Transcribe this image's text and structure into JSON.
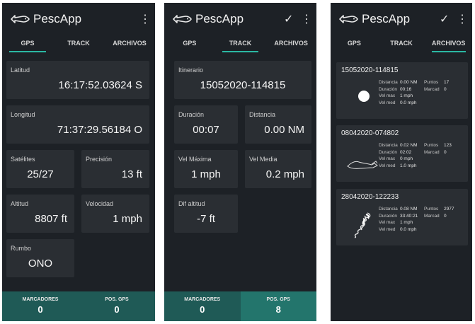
{
  "app": {
    "title": "PescApp"
  },
  "tabs": [
    "GPS",
    "TRACK",
    "ARCHIVOS"
  ],
  "gps_screen": {
    "latitud": {
      "label": "Latitud",
      "value": "16:17:52.03624 S"
    },
    "longitud": {
      "label": "Longitud",
      "value": "71:37:29.56184 O"
    },
    "satelites": {
      "label": "Satélites",
      "value": "25/27"
    },
    "precision": {
      "label": "Precisión",
      "value": "13 ft"
    },
    "altitud": {
      "label": "Altitud",
      "value": "8807 ft"
    },
    "velocidad": {
      "label": "Velocidad",
      "value": "1 mph"
    },
    "rumbo": {
      "label": "Rumbo",
      "value": "ONO"
    },
    "bottom": {
      "marcadores_label": "MARCADORES",
      "marcadores_value": "0",
      "posgps_label": "POS. GPS",
      "posgps_value": "0"
    }
  },
  "track_screen": {
    "itinerario": {
      "label": "Itinerario",
      "value": "15052020-114815"
    },
    "duracion": {
      "label": "Duración",
      "value": "00:07"
    },
    "distancia": {
      "label": "Distancia",
      "value": "0.00 NM"
    },
    "vel_maxima": {
      "label": "Vel Máxima",
      "value": "1 mph"
    },
    "vel_media": {
      "label": "Vel Media",
      "value": "0.2 mph"
    },
    "dif_altitud": {
      "label": "Dif altitud",
      "value": "-7 ft"
    },
    "bottom": {
      "marcadores_label": "MARCADORES",
      "marcadores_value": "0",
      "posgps_label": "POS. GPS",
      "posgps_value": "8"
    }
  },
  "archivos_screen": {
    "stat_labels": {
      "distancia": "Distancia",
      "duracion": "Duración",
      "velmax": "Vel max",
      "velmed": "Vel med",
      "puntos": "Puntos",
      "marcad": "Marcad"
    },
    "tracks": [
      {
        "name": "15052020-114815",
        "distancia": "0.00 NM",
        "duracion": "00:16",
        "velmax": "1 mph",
        "velmed": "0.0 mph",
        "puntos": "17",
        "marcad": "0",
        "thumb": "dot"
      },
      {
        "name": "08042020-074802",
        "distancia": "0.02 NM",
        "duracion": "02:02",
        "velmax": "0 mph",
        "velmed": "1.0 mph",
        "puntos": "123",
        "marcad": "0",
        "thumb": "line"
      },
      {
        "name": "28042020-122233",
        "distancia": "0.08 NM",
        "duracion": "33:40:21",
        "velmax": "1 mph",
        "velmed": "0.0 mph",
        "puntos": "2977",
        "marcad": "0",
        "thumb": "scribble"
      }
    ]
  },
  "icons": {
    "logo": "fish-logo-icon",
    "menu": "more-vert-icon",
    "check": "check-icon"
  },
  "colors": {
    "background": "#1d2126",
    "card": "#2a2e33",
    "accent": "#2bb7a3",
    "bottom_bar": "#1f5a56",
    "bottom_bar_active": "#23756c"
  }
}
